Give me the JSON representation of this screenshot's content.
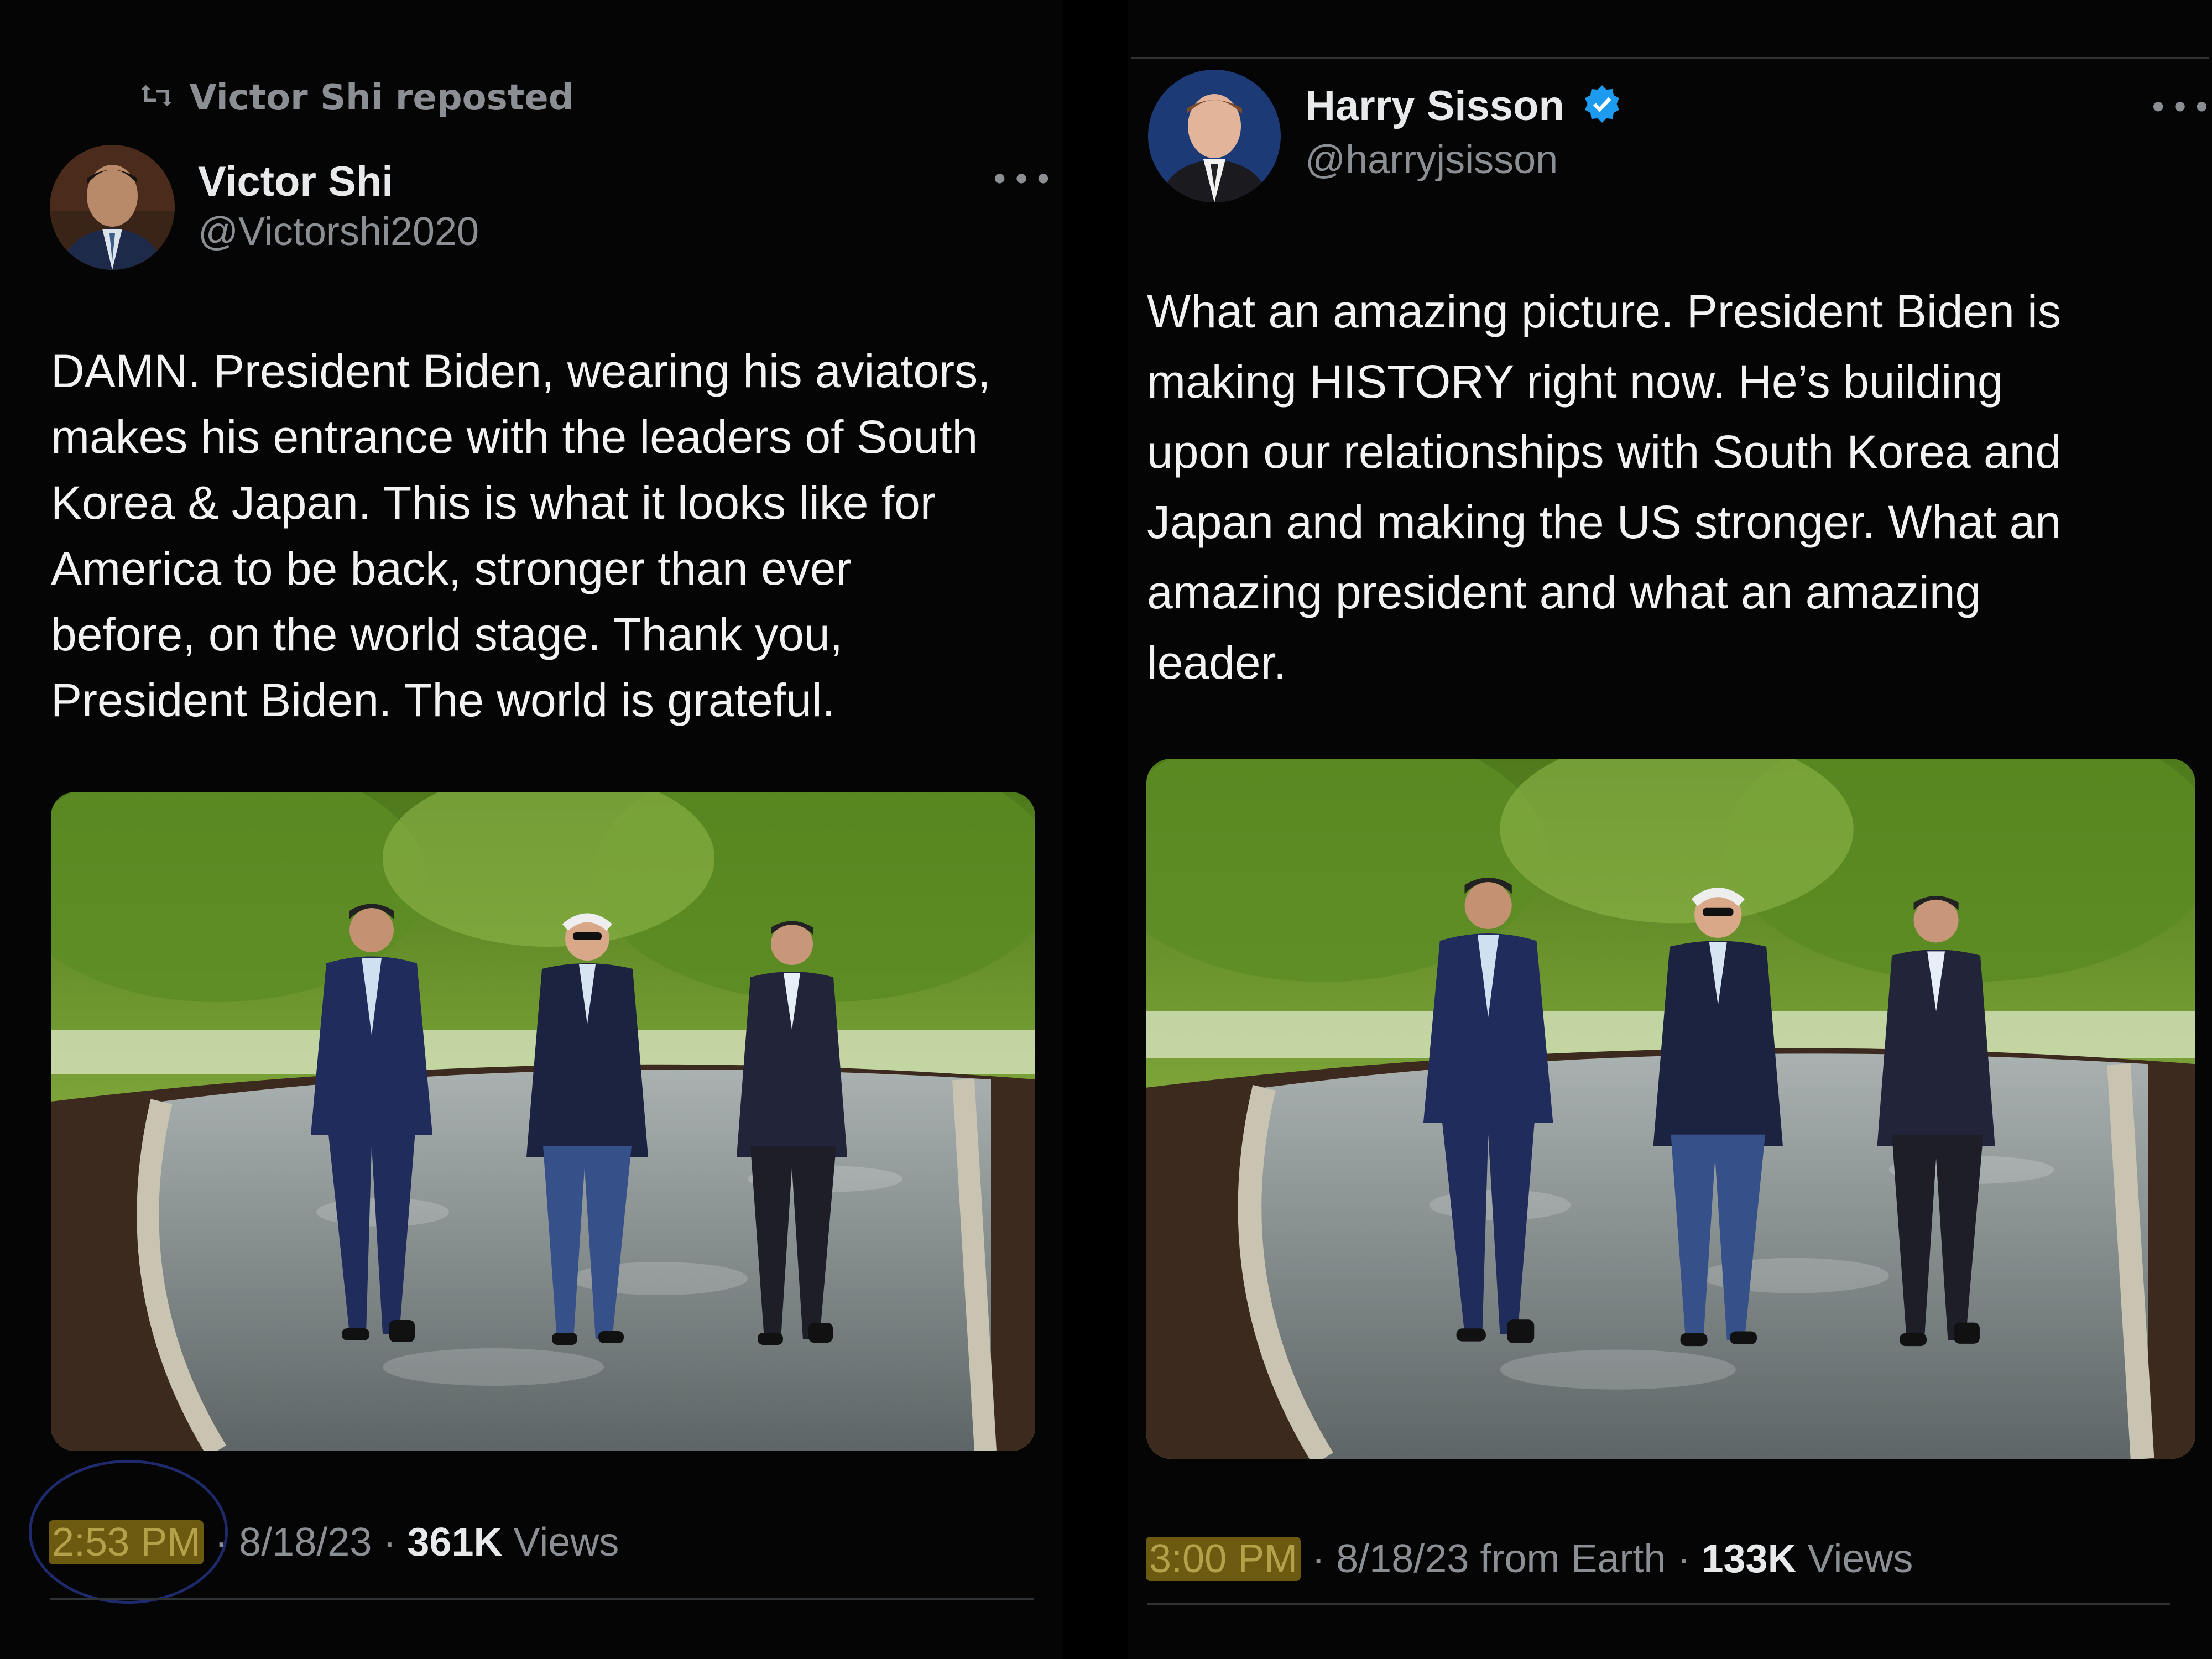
{
  "left_post": {
    "repost_label": "Victor Shi reposted",
    "name": "Victor Shi",
    "handle": "@Victorshi2020",
    "more_label": "•••",
    "text": "DAMN. President Biden, wearing his aviators,\nmakes his entrance with the leaders of South\nKorea & Japan. This is what it looks like for\nAmerica to be back, stronger than ever\nbefore, on the world stage. Thank you,\nPresident Biden. The world is grateful.",
    "time": "2:53 PM",
    "date": "· 8/18/23 ·",
    "views_count": "361K",
    "views_label": "Views"
  },
  "right_post": {
    "name": "Harry Sisson",
    "handle": "@harryjsisson",
    "more_label": "•••",
    "text": "What an amazing picture. President Biden is\nmaking HISTORY right now. He’s building\nupon our relationships with South Korea and\nJapan and making the US stronger. What an\namazing president and what an amazing\nleader.",
    "time": "3:00 PM",
    "date": "· 8/18/23 from Earth ·",
    "views_count": "133K",
    "views_label": "Views"
  },
  "colors": {
    "background": "#000000",
    "text_primary": "#e7e9ea",
    "text_secondary": "#8b8f93",
    "verified_blue": "#1d9bf0",
    "highlight": "#6b5a10",
    "annotation_circle": "#1e2a6b"
  },
  "icons": [
    "repost-icon",
    "more-icon",
    "verified-badge-icon"
  ]
}
